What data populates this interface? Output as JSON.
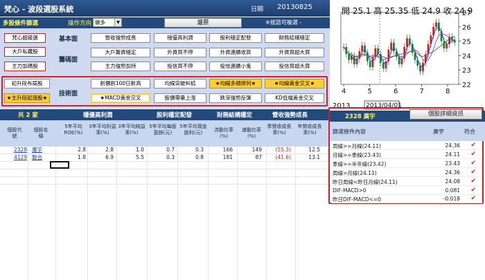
{
  "window": {
    "title": "梵心 - 波段選股系統",
    "date_label": "日期",
    "date_value": "20130825"
  },
  "strip": {
    "section_label": "多股條件篩選",
    "direction_label": "操作方向",
    "direction_value": "做多",
    "reset_label": "還原",
    "hint": "※按語可複選 -"
  },
  "filters": {
    "left_column": [
      "梵心超級選",
      "大戶私藏股",
      "主力加碼股"
    ],
    "tech_left": [
      "初升段布局股",
      "★主升段起漲股★"
    ],
    "categories": {
      "basic": "基本面",
      "chips": "籌碼面",
      "tech": "技術面"
    },
    "basic": [
      "營收強勢成長",
      "穩優高利潤",
      "股利穩定配發",
      "財務結構穩定"
    ],
    "chips_row1": [
      "大戶籌資穩定",
      "外資買不停",
      "外資連續收貨",
      "外資買超大買"
    ],
    "chips_row2": [
      "主力強勢加持",
      "投信買不停",
      "投信連續小鬼",
      "投信買超大買"
    ],
    "tech_row1": [
      "創價創100日新高",
      "均線突破糾結",
      "★均線多頭排列★",
      "★均線黃金交叉★"
    ],
    "tech_row2": [
      "★MACD黃金交叉",
      "股價帶量上漲",
      "跌深強勢反彈",
      "KD低檔黃金交叉"
    ]
  },
  "table": {
    "count_label": "共 2 家",
    "groups": [
      "穩優高利潤",
      "股利穩定配發",
      "財務結構穩定",
      "營收強勢成長"
    ],
    "columns": [
      "個股代號",
      "個股名稱",
      "5年平均ROE(%)",
      "3年平均利益率(%)",
      "3年平均純益率(%)",
      "5年平均每股盈餘(元)",
      "5年平均現金股利(元)",
      "流動比率(%)",
      "速動比率(%)",
      "季營收成長率(%)",
      "年營收成長率(%)"
    ],
    "rows": [
      {
        "code": "2328",
        "name": "廣宇",
        "vals": [
          "2.8",
          "2.8",
          "1.0",
          "0.7",
          "0.3",
          "166",
          "149",
          "(55.3)",
          "12.5"
        ]
      },
      {
        "code": "4129",
        "name": "聯合",
        "vals": [
          "1.8",
          "6.9",
          "5.5",
          "0.3",
          "0.8",
          "181",
          "87",
          "(41.6)",
          "13.1"
        ]
      }
    ]
  },
  "chart": {
    "quote": "開 25.1 高 25.35 低 24.9 收 24.9",
    "y_ticks": [
      "27",
      "26",
      "25",
      "24",
      "23",
      "22"
    ],
    "x_ticks": [
      "4",
      "5",
      "6",
      "7",
      "8"
    ],
    "year_label": "2013",
    "cursor_date": "2013/04/01"
  },
  "chart_data": {
    "type": "line",
    "title": "",
    "xlabel": "",
    "ylabel": "",
    "ylim": [
      22,
      27
    ],
    "x": [
      "4",
      "5",
      "6",
      "7",
      "8"
    ],
    "series": [
      {
        "name": "",
        "values": [
          24.2,
          23.5,
          24.4,
          23.3,
          24.9
        ]
      }
    ]
  },
  "detail": {
    "button_label": "個股詳細資訊",
    "header": "2328 廣宇",
    "col_content": "篩選條件內容",
    "col_stock": "廣宇",
    "col_match": "符合",
    "rows": [
      {
        "cond": "周線>=月線(24.11)",
        "val": "24.36"
      },
      {
        "cond": "月線>=季線(23.43)",
        "val": "24.11"
      },
      {
        "cond": "季線>=半年線(23.42)",
        "val": "23.43"
      },
      {
        "cond": "周線>月線(24.11)",
        "val": "24.36"
      },
      {
        "cond": "昨日周線<昨日月線(24.11)",
        "val": "24.08"
      },
      {
        "cond": "DIF-MACD>0",
        "val": "0.081"
      },
      {
        "cond": "昨日DIF-MACD<=0",
        "val": "-0.018"
      }
    ],
    "check_glyph": "✔"
  },
  "colors": {
    "header": "#24497c",
    "panel": "#cfdaf0",
    "highlight": "#d81c24",
    "gold": "#ffcf3a"
  }
}
